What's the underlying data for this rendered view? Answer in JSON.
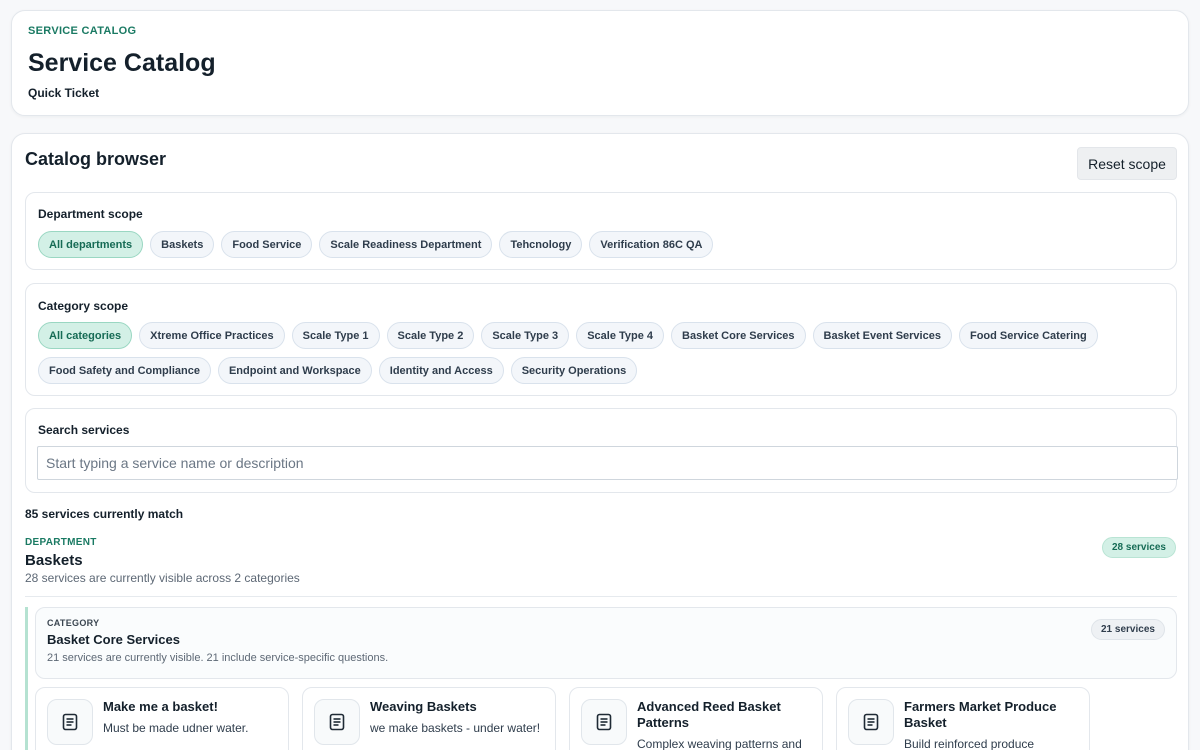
{
  "header": {
    "eyebrow": "SERVICE CATALOG",
    "title": "Service Catalog",
    "quick_ticket": "Quick Ticket"
  },
  "browser": {
    "title": "Catalog browser",
    "reset_label": "Reset scope",
    "department_scope": {
      "label": "Department scope",
      "chips": [
        "All departments",
        "Baskets",
        "Food Service",
        "Scale Readiness Department",
        "Tehcnology",
        "Verification 86C QA"
      ],
      "active": "All departments"
    },
    "category_scope": {
      "label": "Category scope",
      "chips": [
        "All categories",
        "Xtreme Office Practices",
        "Scale Type 1",
        "Scale Type 2",
        "Scale Type 3",
        "Scale Type 4",
        "Basket Core Services",
        "Basket Event Services",
        "Food Service Catering",
        "Food Safety and Compliance",
        "Endpoint and Workspace",
        "Identity and Access",
        "Security Operations"
      ],
      "active": "All categories"
    },
    "search": {
      "label": "Search services",
      "placeholder": "Start typing a service name or description",
      "value": ""
    },
    "match_count": "85 services currently match"
  },
  "department": {
    "eyebrow": "DEPARTMENT",
    "name": "Baskets",
    "description": "28 services are currently visible across 2 categories",
    "count": "28 services"
  },
  "category": {
    "eyebrow": "CATEGORY",
    "name": "Basket Core Services",
    "description": "21 services are currently visible. 21 include service-specific questions.",
    "count": "21 services"
  },
  "services": [
    {
      "title": "Make me a basket!",
      "description": "Must be made udner water.",
      "icon": "document-icon"
    },
    {
      "title": "Weaving Baskets",
      "description": "we make baskets - under water!",
      "icon": "document-icon"
    },
    {
      "title": "Advanced Reed Basket Patterns",
      "description": "Complex weaving patterns and",
      "icon": "document-icon"
    },
    {
      "title": "Farmers Market Produce Basket",
      "description": "Build reinforced produce",
      "icon": "document-icon"
    }
  ],
  "colors": {
    "accent": "#1a7a63",
    "active_chip_bg": "#d3f0e6",
    "chip_bg": "#f3f6fa",
    "background": "#f7f8fa"
  }
}
